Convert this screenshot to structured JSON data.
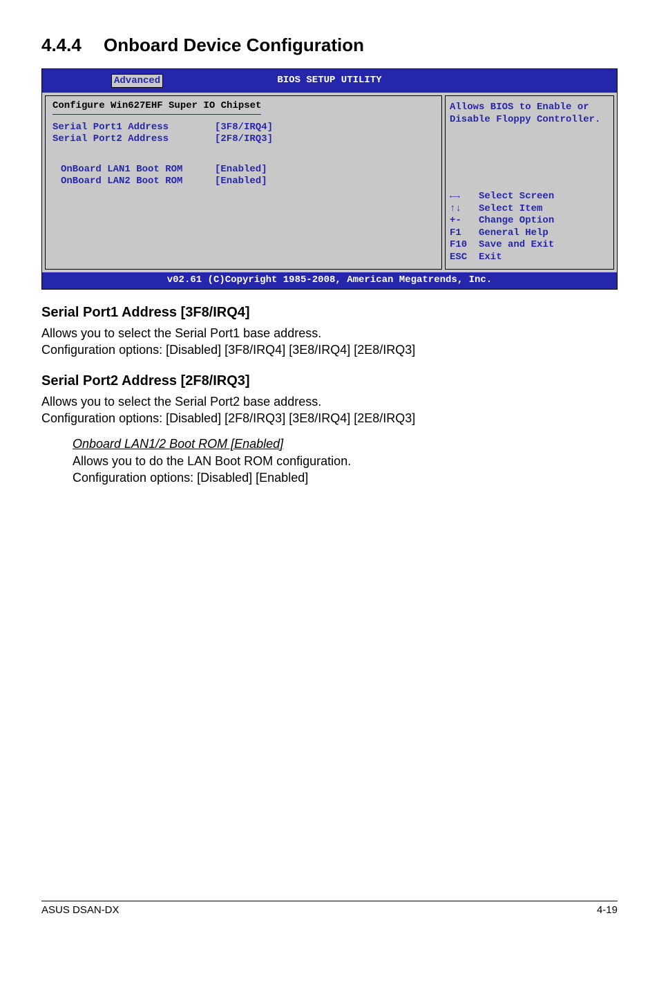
{
  "heading": {
    "num": "4.4.4",
    "title": "Onboard Device Configuration"
  },
  "bios": {
    "header_title": "BIOS SETUP UTILITY",
    "tab": "Advanced",
    "section_title": "Configure Win627EHF Super IO Chipset",
    "rows": [
      {
        "label": "Serial Port1 Address",
        "value": "[3F8/IRQ4]"
      },
      {
        "label": "Serial Port2 Address",
        "value": "[2F8/IRQ3]"
      }
    ],
    "rows2": [
      {
        "label": "OnBoard LAN1 Boot ROM",
        "value": "[Enabled]"
      },
      {
        "label": "OnBoard LAN2 Boot ROM",
        "value": "[Enabled]"
      }
    ],
    "help_text": "Allows BIOS to Enable or Disable Floppy Controller.",
    "nav": [
      {
        "key": "←→",
        "label": "Select Screen"
      },
      {
        "key": "↑↓",
        "label": "Select Item"
      },
      {
        "key": "+-",
        "label": "Change Option"
      },
      {
        "key": "F1",
        "label": "General Help"
      },
      {
        "key": "F10",
        "label": "Save and Exit"
      },
      {
        "key": "ESC",
        "label": "Exit"
      }
    ],
    "footer": "v02.61 (C)Copyright 1985-2008, American Megatrends, Inc."
  },
  "section1": {
    "title": "Serial Port1 Address [3F8/IRQ4]",
    "line1": "Allows you to select the Serial Port1 base address.",
    "line2": "Configuration options: [Disabled] [3F8/IRQ4] [3E8/IRQ4] [2E8/IRQ3]"
  },
  "section2": {
    "title": "Serial Port2 Address [2F8/IRQ3]",
    "line1": "Allows you to select the Serial Port2 base address.",
    "line2": "Configuration options: [Disabled] [2F8/IRQ3] [3E8/IRQ4] [2E8/IRQ3]"
  },
  "sub1": {
    "title": "Onboard LAN1/2 Boot ROM [Enabled]",
    "line1": "Allows you to do the LAN Boot ROM configuration.",
    "line2": "Configuration options: [Disabled] [Enabled]"
  },
  "footer": {
    "left": "ASUS DSAN-DX",
    "right": "4-19"
  }
}
